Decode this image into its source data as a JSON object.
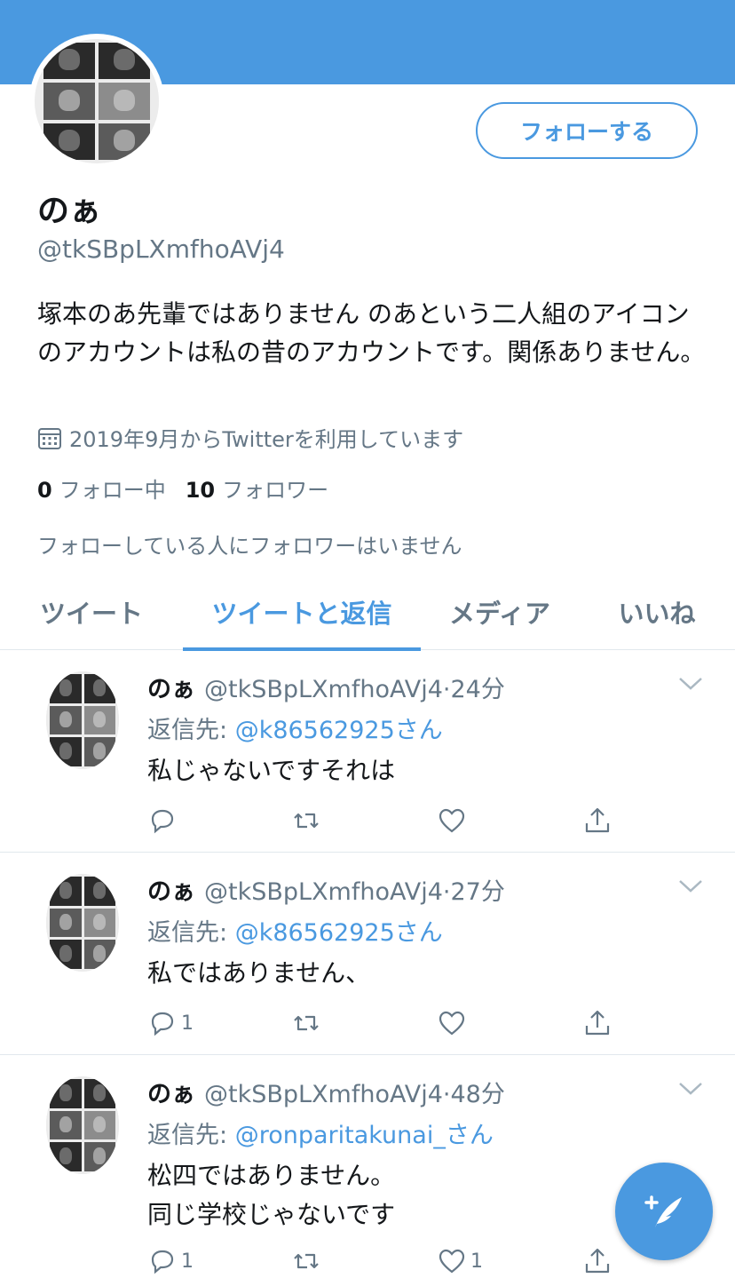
{
  "profile": {
    "follow_label": "フォローする",
    "name": "のぁ",
    "handle": "@tkSBpLXmfhoAVj4",
    "bio": "塚本のあ先輩ではありません のあという二人組のアイコンのアカウントは私の昔のアカウントです。関係ありません。",
    "joined": "2019年9月からTwitterを利用しています",
    "following_count": "0",
    "following_label": "フォロー中",
    "followers_count": "10",
    "followers_label": "フォロワー",
    "no_followers_you_know": "フォローしている人にフォロワーはいません"
  },
  "tabs": [
    "ツイート",
    "ツイートと返信",
    "メディア",
    "いいね"
  ],
  "active_tab": "ツイートと返信",
  "tweets": [
    {
      "name": "のぁ",
      "handle": "@tkSBpLXmfhoAVj4",
      "time": "24分",
      "reply_prefix": "返信先: ",
      "reply_to": "@k86562925さん",
      "text": "私じゃないですそれは",
      "reply_count": "",
      "like_count": ""
    },
    {
      "name": "のぁ",
      "handle": "@tkSBpLXmfhoAVj4",
      "time": "27分",
      "reply_prefix": "返信先: ",
      "reply_to": "@k86562925さん",
      "text": "私ではありません、",
      "reply_count": "1",
      "like_count": ""
    },
    {
      "name": "のぁ",
      "handle": "@tkSBpLXmfhoAVj4",
      "time": "48分",
      "reply_prefix": "返信先: ",
      "reply_to": "@ronparitakunai_さん",
      "text": "松四ではありません。\n同じ学校じゃないです",
      "reply_count": "1",
      "like_count": "1"
    }
  ],
  "icons": {
    "calendar": "calendar-icon",
    "reply": "reply-icon",
    "retweet": "retweet-icon",
    "like": "heart-icon",
    "share": "share-icon",
    "menu": "chevron-down-icon",
    "compose": "compose-tweet-icon"
  },
  "colors": {
    "accent": "#4a99e0",
    "secondary_text": "#657786",
    "primary_text": "#14171a"
  }
}
